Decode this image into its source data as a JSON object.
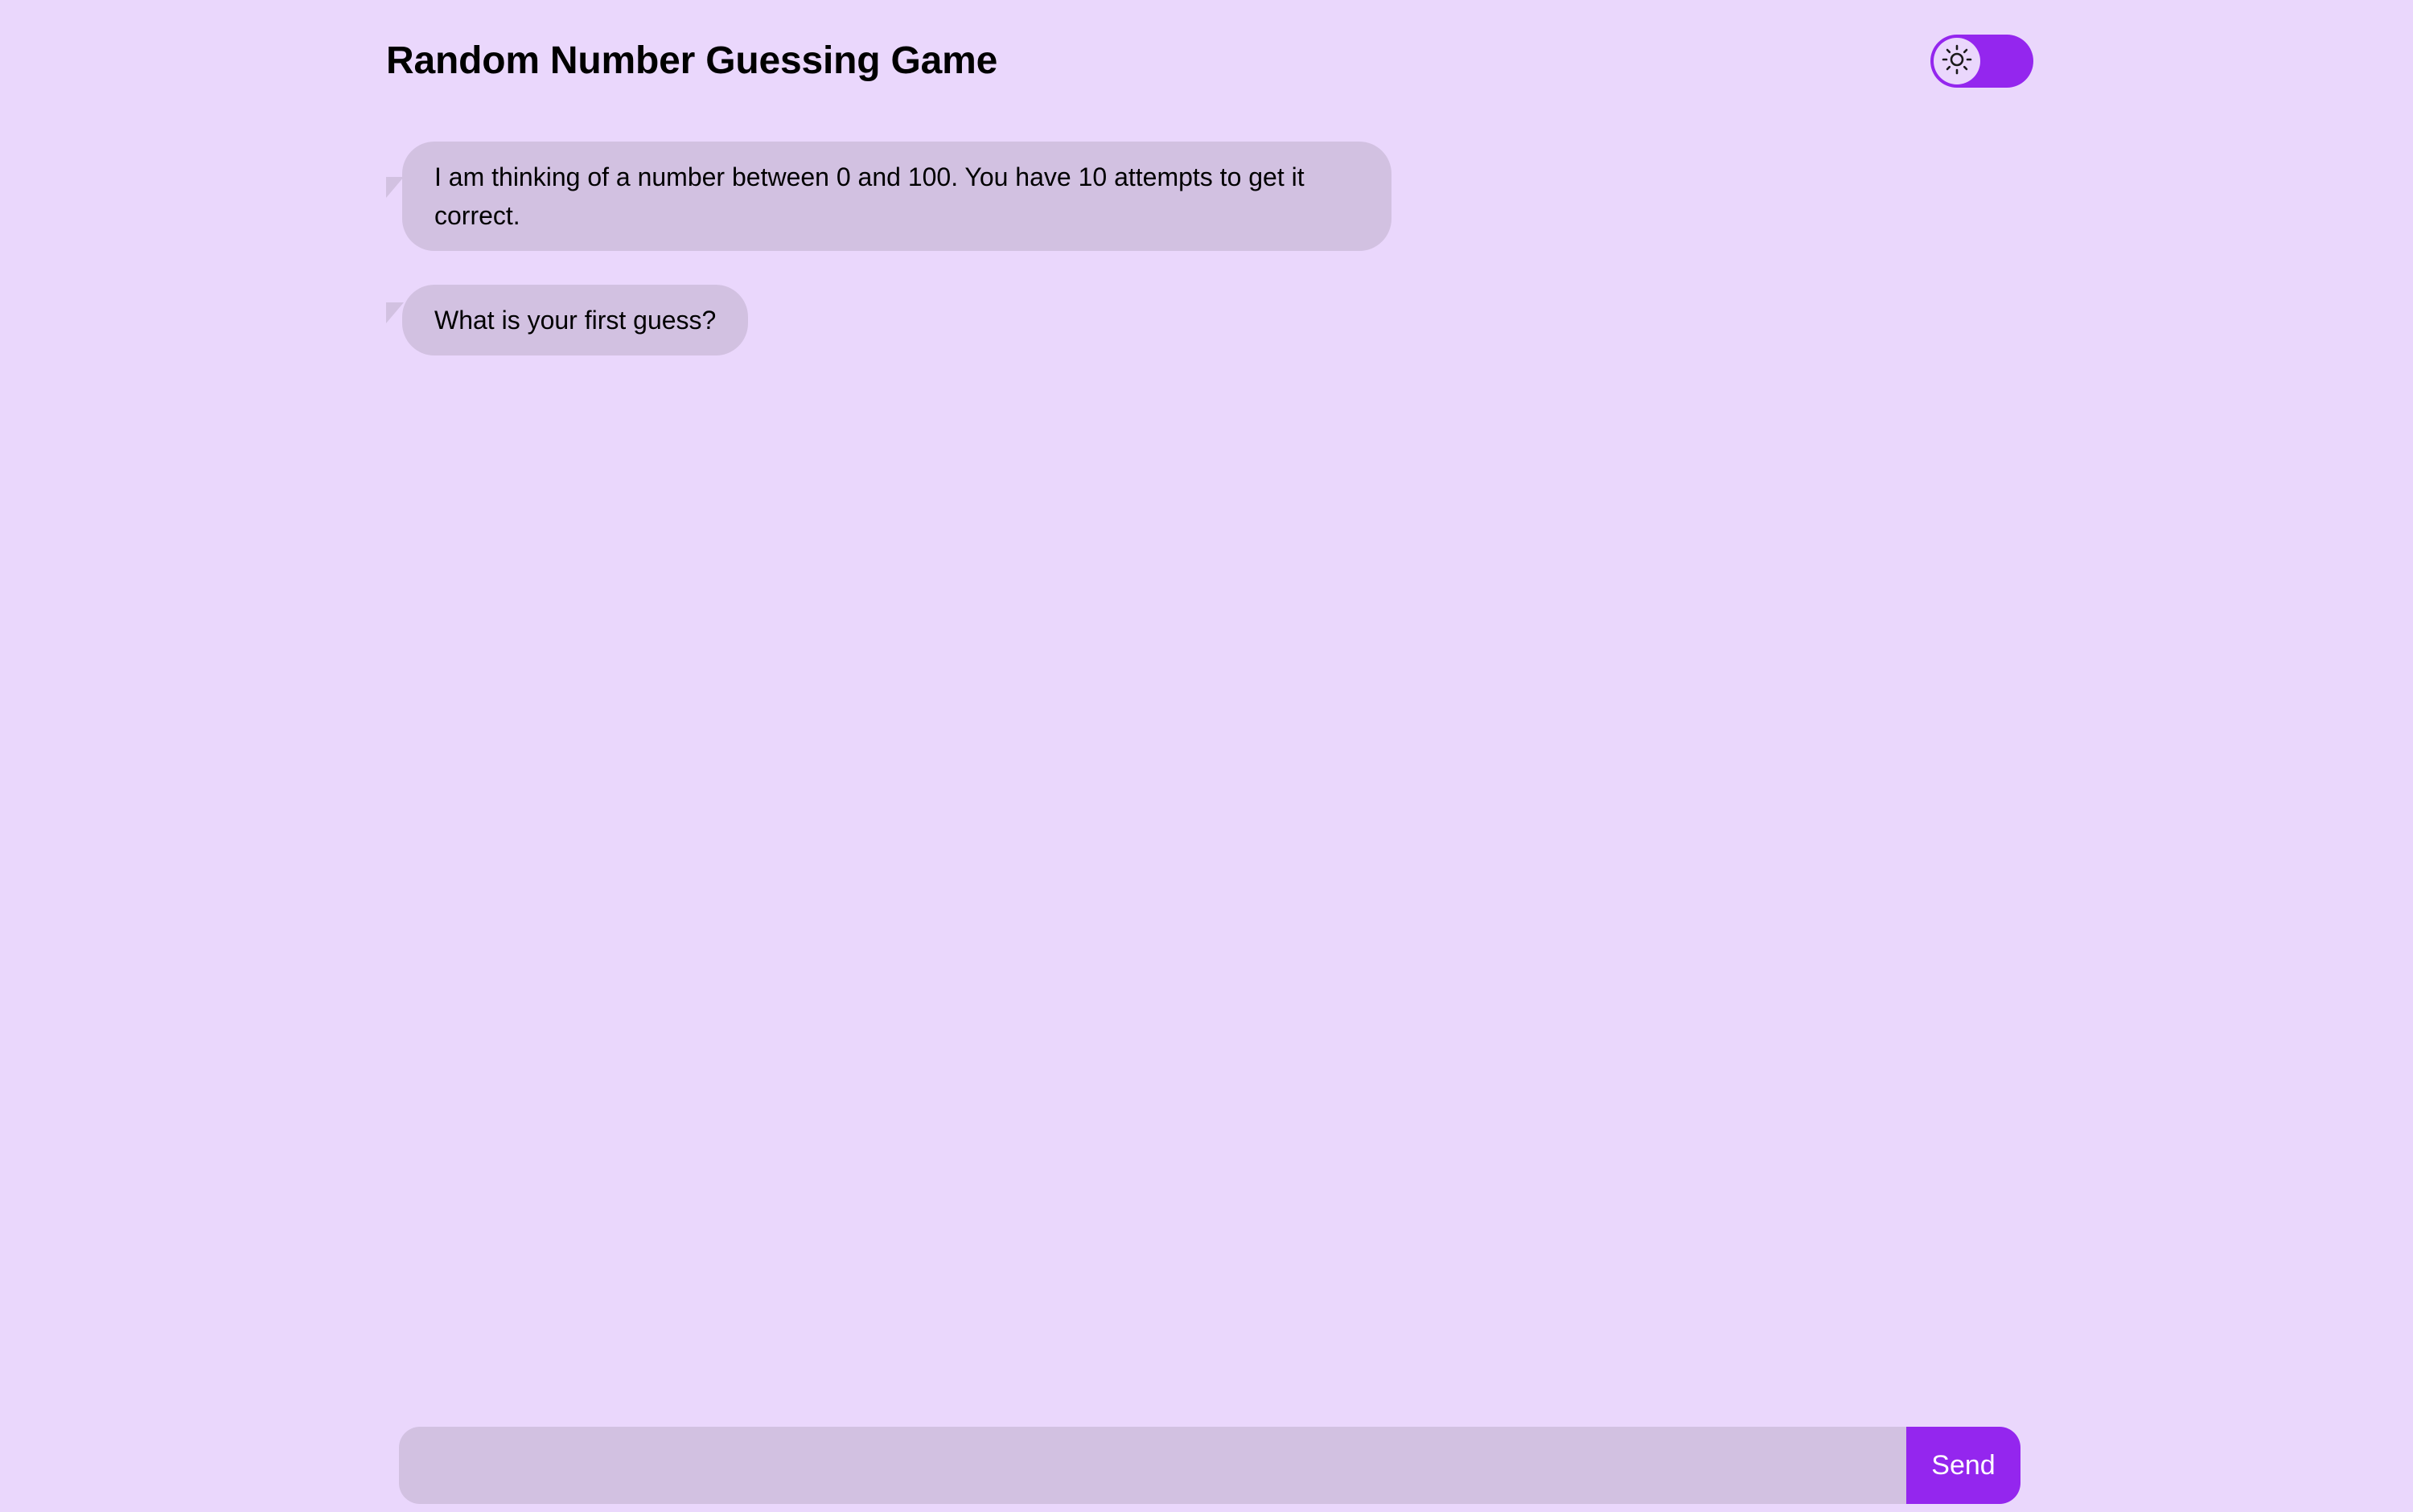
{
  "header": {
    "title": "Random Number Guessing Game",
    "theme_toggle": {
      "icon": "sun-icon",
      "state": "light"
    }
  },
  "messages": [
    {
      "text": "I am thinking of a number between 0 and 100. You have 10 attempts to get it correct."
    },
    {
      "text": "What is your first guess?"
    }
  ],
  "composer": {
    "input_value": "",
    "input_placeholder": "",
    "send_label": "Send"
  },
  "colors": {
    "background": "#ead7fc",
    "bubble": "#d2c1e1",
    "accent": "#9426ee"
  }
}
